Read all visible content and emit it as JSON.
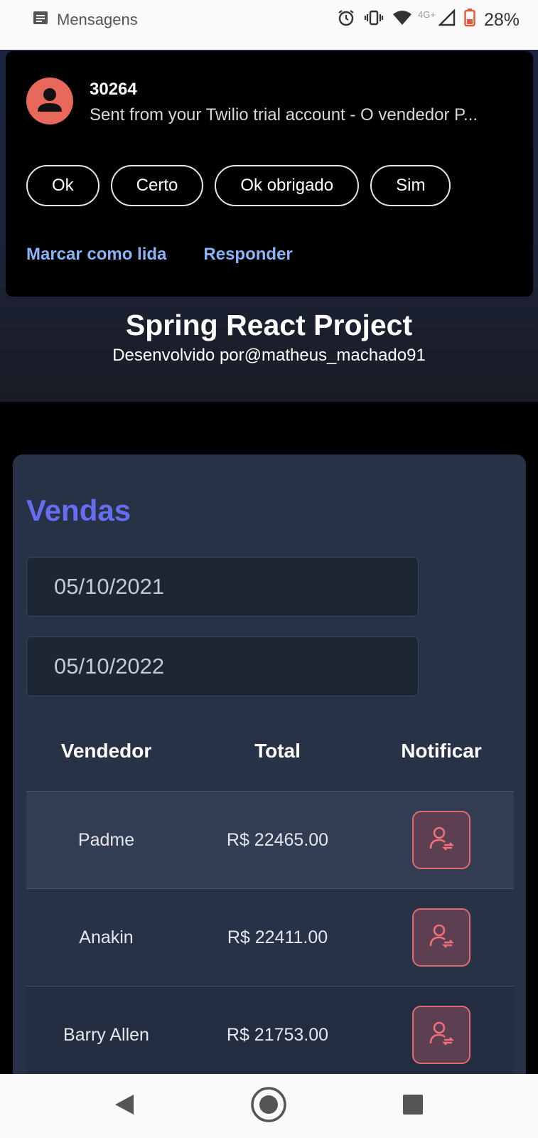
{
  "status_bar": {
    "app_label": "Mensagens",
    "network": "4G+",
    "battery": "28%"
  },
  "notification": {
    "sender": "30264",
    "text": "Sent from your Twilio trial account - O vendedor P...",
    "quick_replies": [
      "Ok",
      "Certo",
      "Ok obrigado",
      "Sim"
    ],
    "actions": [
      "Marcar como lida",
      "Responder"
    ],
    "action_color": "#8ab4f8",
    "avatar_color": "#e8695c"
  },
  "header": {
    "title": "Spring React Project",
    "subtitle": "Desenvolvido por@matheus_machado91"
  },
  "sales": {
    "title": "Vendas",
    "title_color": "#656ef0",
    "date_min": "05/10/2021",
    "date_max": "05/10/2022",
    "columns": [
      "Vendedor",
      "Total",
      "Notificar"
    ],
    "rows": [
      {
        "seller": "Padme",
        "total": "R$ 22465.00"
      },
      {
        "seller": "Anakin",
        "total": "R$ 22411.00"
      },
      {
        "seller": "Barry Allen",
        "total": "R$ 21753.00"
      }
    ],
    "notify_icon": "user-notify-icon",
    "accent_color": "#e06a72"
  },
  "nav_bar": {
    "buttons": [
      "back-icon",
      "home-icon",
      "recents-icon"
    ]
  }
}
